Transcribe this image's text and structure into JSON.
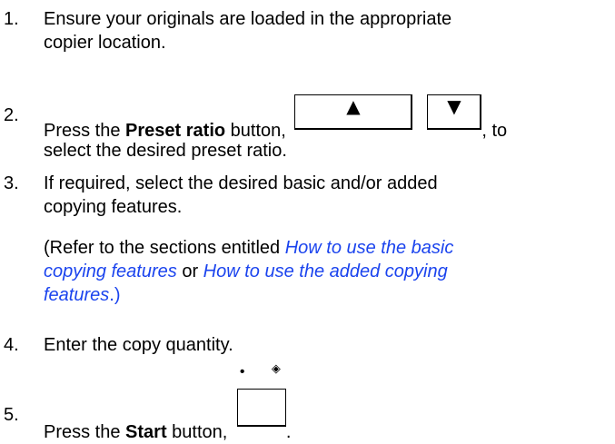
{
  "steps": [
    {
      "number": "1.",
      "line1": "Ensure your originals are loaded in the appropriate",
      "line2": "copier location."
    },
    {
      "number": "2.",
      "pre": "Press the ",
      "bold": "Preset ratio",
      "mid": " button,",
      "post": ", to",
      "line2": "select the desired preset ratio.",
      "up_glyph": "▲",
      "down_glyph": "▼"
    },
    {
      "number": "3.",
      "line1": "If required, select the desired basic and/or added",
      "line2": "copying features.",
      "note_open": "(Refer to the sections entitled ",
      "link1": "How to use the basic",
      "link1b": "copying features",
      "or": " or ",
      "link2": "How to use the added copying",
      "link2b": "features",
      "note_close": ".)"
    },
    {
      "number": "4.",
      "line1": "Enter the copy quantity."
    },
    {
      "number": "5.",
      "pre": "Press the ",
      "bold": "Start",
      "mid": " button,",
      "post": ".",
      "dot_glyph": "•",
      "diamond_glyph": "◈"
    }
  ]
}
